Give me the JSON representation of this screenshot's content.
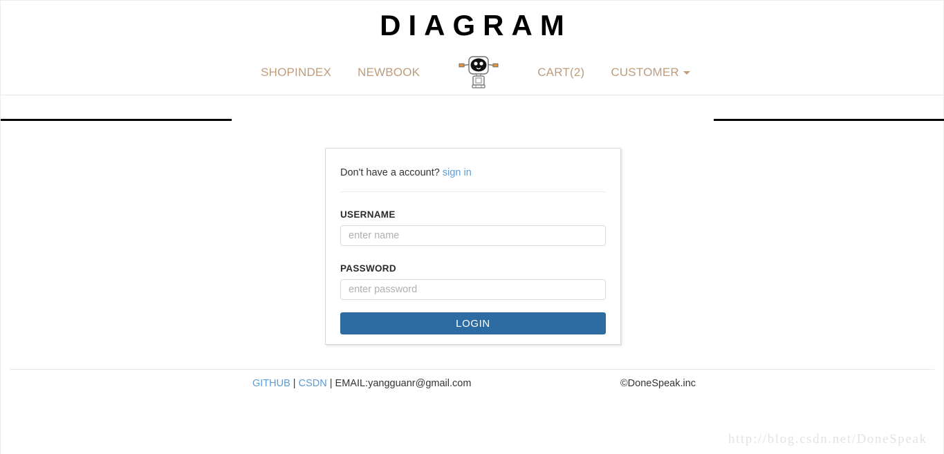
{
  "header": {
    "brand": "DIAGRAM"
  },
  "nav": {
    "logo_icon": "robot-mascot-icon",
    "left_items": [
      {
        "label": "SHOPINDEX",
        "name": "nav-item-shopindex"
      },
      {
        "label": "NEWBOOK",
        "name": "nav-item-newbook"
      }
    ],
    "right_items": [
      {
        "label": "CART(2)",
        "name": "nav-item-cart",
        "has_caret": false
      },
      {
        "label": "CUSTOMER",
        "name": "nav-item-customer",
        "has_caret": true
      }
    ]
  },
  "login_card": {
    "signup_prompt": "Don't have a account?",
    "signup_link": "sign in",
    "username_label": "USERNAME",
    "username_value": "",
    "username_placeholder": "enter name",
    "password_label": "PASSWORD",
    "password_value": "",
    "password_placeholder": "enter password",
    "submit_label": "LOGIN"
  },
  "footer": {
    "github_label": "GITHUB",
    "sep1": " | ",
    "csdn_label": "CSDN",
    "sep2": " | ",
    "email_label": "EMAIL:yangguanr@gmail.com",
    "copyright": "©DoneSpeak.inc"
  },
  "watermark": {
    "text": "http://blog.csdn.net/DoneSpeak"
  },
  "colors": {
    "nav_link": "#bd9c7c",
    "link_blue": "#5b9bd5",
    "button_blue": "#2d6ca2",
    "rule_black": "#000000"
  }
}
